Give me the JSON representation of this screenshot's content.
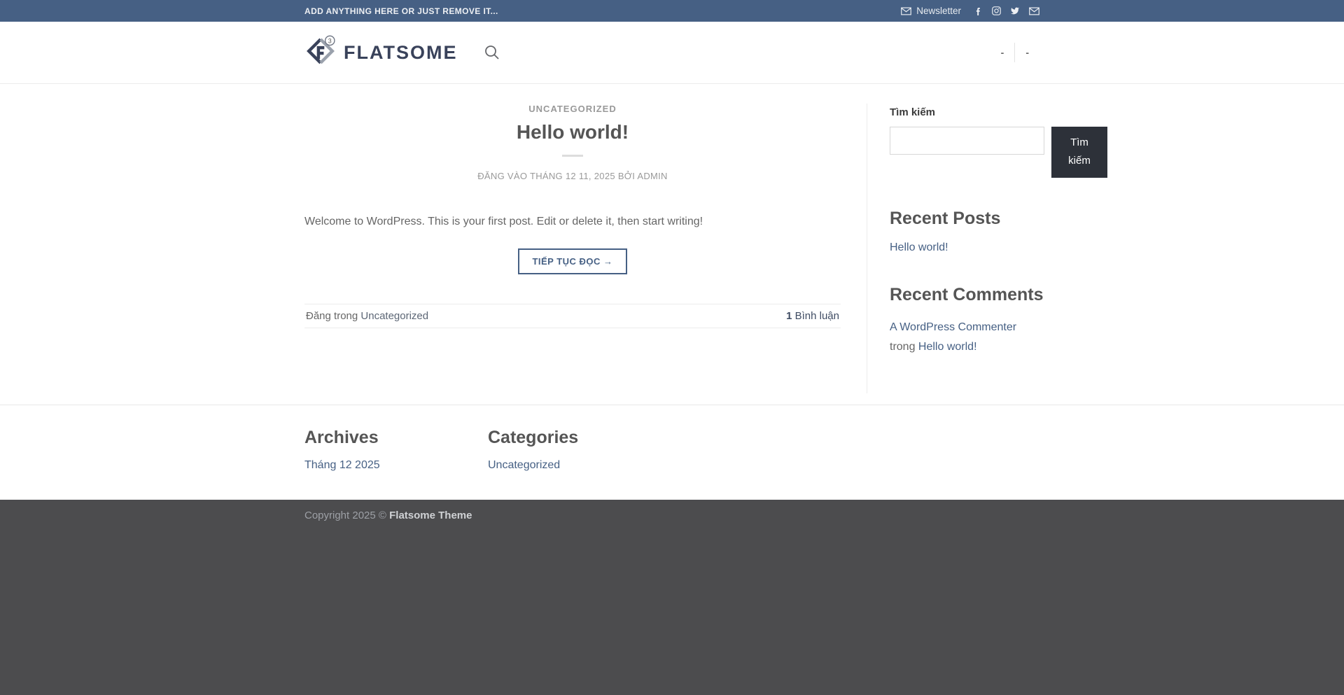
{
  "topbar": {
    "message": "ADD ANYTHING HERE OR JUST REMOVE IT...",
    "newsletter_label": "Newsletter",
    "bg_color": "#466084"
  },
  "header": {
    "logo_text": "FLATSOME",
    "logo_badge": "3",
    "nav_items": {
      "first": "-",
      "second": "-"
    }
  },
  "post": {
    "category": "UNCATEGORIZED",
    "title": "Hello world!",
    "meta_prefix": "ĐĂNG VÀO",
    "meta_date": "THÁNG 12 11, 2025",
    "meta_by": "BỞI",
    "meta_author": "ADMIN",
    "excerpt": "Welcome to WordPress. This is your first post. Edit or delete it, then start writing!",
    "read_more_label": "TIẾP TỤC ĐỌC →",
    "posted_in_prefix": "Đăng trong",
    "posted_in_category": "Uncategorized",
    "comments_count": "1",
    "comments_label": "Bình luận"
  },
  "sidebar": {
    "search": {
      "label": "Tìm kiếm",
      "button_label": "Tìm kiếm",
      "value": ""
    },
    "recent_posts": {
      "title": "Recent Posts",
      "items": {
        "0": "Hello world!"
      }
    },
    "recent_comments": {
      "title": "Recent Comments",
      "author": "A WordPress Commenter",
      "connector": "trong",
      "post": "Hello world!"
    }
  },
  "footer": {
    "archives": {
      "title": "Archives",
      "items": {
        "0": "Tháng 12 2025"
      }
    },
    "categories": {
      "title": "Categories",
      "items": {
        "0": "Uncategorized"
      }
    },
    "copyright_prefix": "Copyright 2025 ©",
    "copyright_brand": "Flatsome Theme"
  },
  "colors": {
    "primary": "#466084",
    "topbar_bg": "#466084",
    "heading_text": "#555555",
    "body_text": "#666666",
    "muted_text": "#999999",
    "search_button_bg": "#2d3139",
    "dark_footer_bg": "#4c4c4e",
    "logo_navy": "#39425a",
    "logo_gray": "#9aa1ac"
  }
}
